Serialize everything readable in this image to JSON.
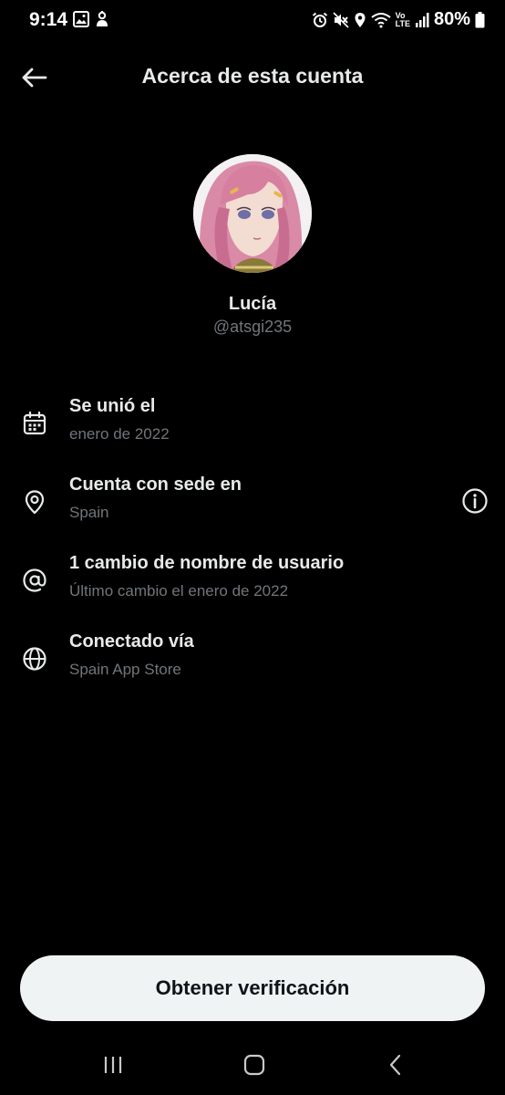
{
  "status_bar": {
    "time": "9:14",
    "battery": "80%",
    "icons_left": [
      "gallery-icon",
      "person-alert-icon"
    ],
    "icons_right": [
      "alarm-icon",
      "mute-icon",
      "location-icon",
      "wifi-icon",
      "volte-icon",
      "signal-icon",
      "battery-icon"
    ],
    "volte_label_top": "Vo",
    "volte_label_bottom": "LTE"
  },
  "header": {
    "title": "Acerca de esta cuenta",
    "back_icon": "arrow-left-icon"
  },
  "profile": {
    "name": "Lucía",
    "handle": "@atsgi235"
  },
  "info_items": [
    {
      "icon": "calendar-icon",
      "title": "Se unió el",
      "subtitle": "enero de 2022"
    },
    {
      "icon": "location-pin-icon",
      "title": "Cuenta con sede en",
      "subtitle": "Spain",
      "action_icon": "info-icon"
    },
    {
      "icon": "at-sign-icon",
      "title": "1 cambio de nombre de usuario",
      "subtitle": "Último cambio el enero de 2022"
    },
    {
      "icon": "globe-icon",
      "title": "Conectado vía",
      "subtitle": "Spain App Store"
    }
  ],
  "cta": {
    "label": "Obtener verificación"
  },
  "nav_bar": {
    "recents_icon": "recents-icon",
    "home_icon": "home-icon",
    "back_icon": "nav-back-icon"
  },
  "colors": {
    "background": "#000000",
    "primary_text": "#e7e9ea",
    "secondary_text": "#71767b",
    "button_bg": "#eff3f4",
    "button_text": "#0f1419"
  }
}
